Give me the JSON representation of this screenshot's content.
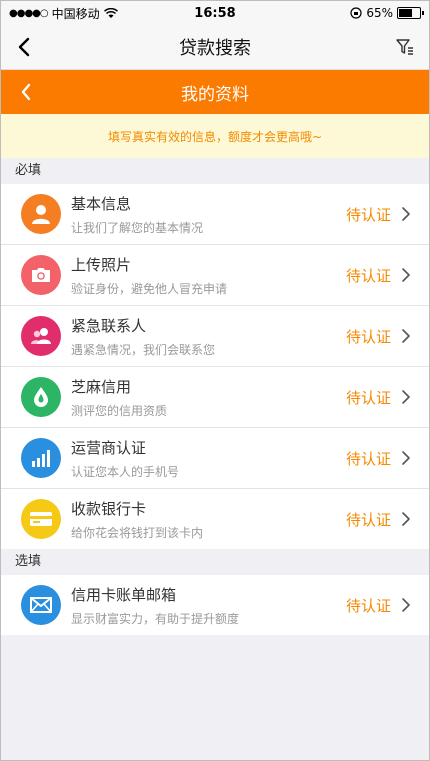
{
  "status_bar": {
    "carrier": "中国移动",
    "time": "16:58",
    "battery": "65%",
    "battery_level": 0.65
  },
  "nav": {
    "title": "贷款搜索"
  },
  "header": {
    "title": "我的资料"
  },
  "notice": "填写真实有效的信息，额度才会更高哦~",
  "sections": {
    "required": {
      "title": "必填",
      "items": [
        {
          "title": "基本信息",
          "subtitle": "让我们了解您的基本情况",
          "status": "待认证",
          "icon": "person-icon",
          "color": "#f57d22"
        },
        {
          "title": "上传照片",
          "subtitle": "验证身份，避免他人冒充申请",
          "status": "待认证",
          "icon": "camera-icon",
          "color": "#f26268"
        },
        {
          "title": "紧急联系人",
          "subtitle": "遇紧急情况，我们会联系您",
          "status": "待认证",
          "icon": "contacts-icon",
          "color": "#e22d6c"
        },
        {
          "title": "芝麻信用",
          "subtitle": "测评您的信用资质",
          "status": "待认证",
          "icon": "sesame-credit-icon",
          "color": "#2bb565"
        },
        {
          "title": "运营商认证",
          "subtitle": "认证您本人的手机号",
          "status": "待认证",
          "icon": "signal-bars-icon",
          "color": "#2b8fdf"
        },
        {
          "title": "收款银行卡",
          "subtitle": "给你花会将钱打到该卡内",
          "status": "待认证",
          "icon": "bank-card-icon",
          "color": "#f5c916"
        }
      ]
    },
    "optional": {
      "title": "选填",
      "items": [
        {
          "title": "信用卡账单邮箱",
          "subtitle": "显示财富实力，有助于提升额度",
          "status": "待认证",
          "icon": "mail-icon",
          "color": "#2b8fdf"
        }
      ]
    }
  }
}
